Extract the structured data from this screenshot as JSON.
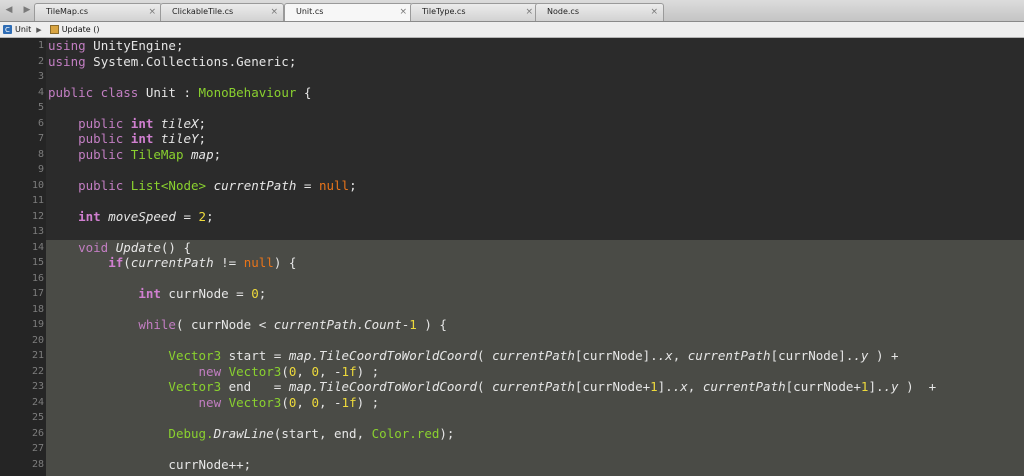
{
  "tabs": [
    {
      "label": "TileMap.cs",
      "active": false
    },
    {
      "label": "ClickableTile.cs",
      "active": false
    },
    {
      "label": "Unit.cs",
      "active": true
    },
    {
      "label": "TileType.cs",
      "active": false
    },
    {
      "label": "Node.cs",
      "active": false
    }
  ],
  "tab_close_symbol": "×",
  "breadcrumb": {
    "class_name": "Unit",
    "member_name": "Update ()"
  },
  "line_numbers": [
    "1",
    "2",
    "3",
    "4",
    "5",
    "6",
    "7",
    "8",
    "9",
    "10",
    "11",
    "12",
    "13",
    "14",
    "15",
    "16",
    "17",
    "18",
    "19",
    "20",
    "21",
    "22",
    "23",
    "24",
    "25",
    "26",
    "27",
    "28"
  ],
  "code": {
    "l1": [
      "using",
      " UnityEngine;"
    ],
    "l2": [
      "using",
      " System.Collections.Generic;"
    ],
    "l4": [
      "public class",
      " Unit : ",
      "MonoBehaviour",
      " {"
    ],
    "l6": [
      "    ",
      "public",
      " ",
      "int",
      " ",
      "tileX",
      ";"
    ],
    "l7": [
      "    ",
      "public",
      " ",
      "int",
      " ",
      "tileY",
      ";"
    ],
    "l8": [
      "    ",
      "public",
      " ",
      "TileMap",
      " ",
      "map",
      ";"
    ],
    "l10": [
      "    ",
      "public",
      " ",
      "List<Node>",
      " ",
      "currentPath",
      " = ",
      "null",
      ";"
    ],
    "l12": [
      "    ",
      "int",
      " ",
      "moveSpeed",
      " = ",
      "2",
      ";"
    ],
    "l14": [
      "    ",
      "void",
      " ",
      "Update",
      "() {"
    ],
    "l15": [
      "        ",
      "if",
      "(",
      "currentPath",
      " != ",
      "null",
      ") {"
    ],
    "l17": [
      "            ",
      "int",
      " currNode = ",
      "0",
      ";"
    ],
    "l19": [
      "            ",
      "while",
      "( currNode < ",
      "currentPath.Count",
      "-",
      "1",
      " ) {"
    ],
    "l21": [
      "                ",
      "Vector3",
      " start = ",
      "map.TileCoordToWorldCoord",
      "( ",
      "currentPath",
      "[currNode].",
      ".x",
      ", ",
      "currentPath",
      "[currNode].",
      ".y",
      " ) +"
    ],
    "l22": [
      "                    ",
      "new",
      " ",
      "Vector3",
      "(",
      "0",
      ", ",
      "0",
      ", -",
      "1f",
      ") ;"
    ],
    "l23": [
      "                ",
      "Vector3",
      " end   = ",
      "map.TileCoordToWorldCoord",
      "( ",
      "currentPath",
      "[currNode+",
      "1",
      "].",
      ".x",
      ", ",
      "currentPath",
      "[currNode+",
      "1",
      "].",
      ".y",
      " )  +"
    ],
    "l24": [
      "                    ",
      "new",
      " ",
      "Vector3",
      "(",
      "0",
      ", ",
      "0",
      ", -",
      "1f",
      ") ;"
    ],
    "l26": [
      "                ",
      "Debug.",
      "DrawLine",
      "(start, end, ",
      "Color.red",
      ");"
    ],
    "l28": [
      "                ",
      "currNode++;"
    ]
  },
  "colors": {
    "keyword": "#c27ec2",
    "type": "#8ad12f",
    "literal_null": "#e8741a",
    "number": "#eeda3b",
    "text": "#e6e6e6",
    "current_scope_highlight": "#4a4b46",
    "background": "#2b2b2b"
  },
  "icons": {
    "nav_back": "triangle-left-icon",
    "nav_forward": "triangle-right-icon",
    "class": "class-icon",
    "method": "method-icon",
    "crumb_separator": "chevron-right-icon",
    "tab_close": "close-icon"
  }
}
